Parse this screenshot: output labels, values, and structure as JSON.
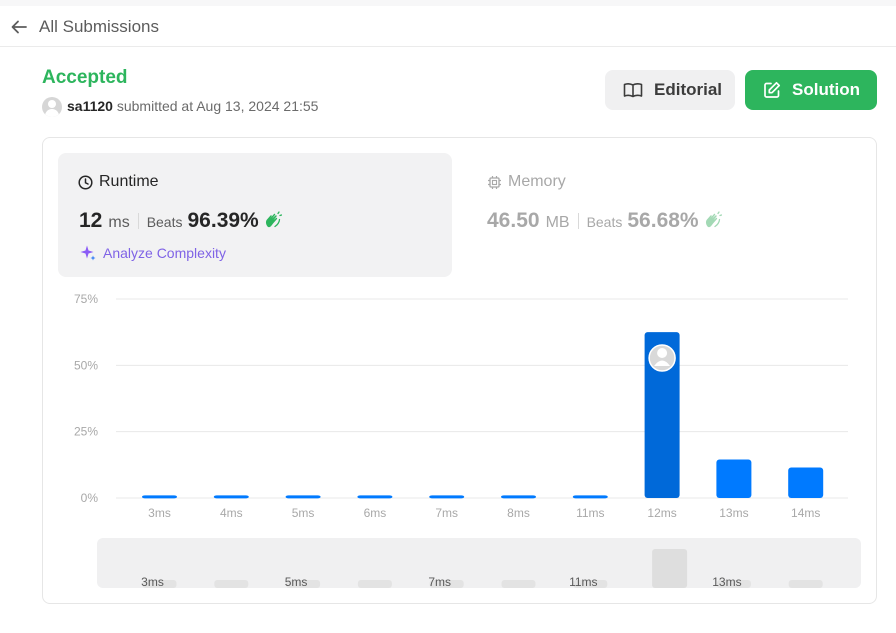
{
  "header": {
    "back_label": "All Submissions"
  },
  "submission": {
    "status": "Accepted",
    "username": "sa1120",
    "submitted_text": "submitted at Aug 13, 2024 21:55"
  },
  "actions": {
    "editorial_label": "Editorial",
    "solution_label": "Solution"
  },
  "runtime": {
    "title": "Runtime",
    "value": "12",
    "unit": "ms",
    "beats_label": "Beats",
    "beats_pct": "96.39%",
    "analyze_label": "Analyze Complexity"
  },
  "memory": {
    "title": "Memory",
    "value": "46.50",
    "unit": "MB",
    "beats_label": "Beats",
    "beats_pct": "56.68%"
  },
  "colors": {
    "accepted": "#2db55d",
    "bar": "#007aff",
    "bar_highlight": "#0069d9",
    "analyze": "#7f63e6"
  },
  "chart_data": {
    "type": "bar",
    "categories": [
      "3ms",
      "4ms",
      "5ms",
      "6ms",
      "7ms",
      "8ms",
      "11ms",
      "12ms",
      "13ms",
      "14ms"
    ],
    "values": [
      1,
      1,
      1,
      1,
      1,
      1,
      1,
      62.5,
      14.5,
      11.5
    ],
    "highlight_category": "12ms",
    "y_ticks": [
      "0%",
      "25%",
      "50%",
      "75%"
    ],
    "ylim": [
      0,
      75
    ],
    "grid": true,
    "navigator": {
      "labels": [
        "3ms",
        "5ms",
        "7ms",
        "11ms",
        "13ms"
      ],
      "highlight_category": "12ms"
    }
  }
}
